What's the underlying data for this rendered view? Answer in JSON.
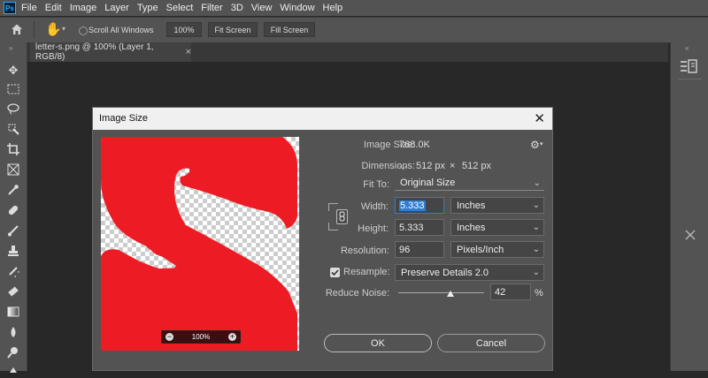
{
  "menu": {
    "logo": "Ps",
    "items": [
      "File",
      "Edit",
      "Image",
      "Layer",
      "Type",
      "Select",
      "Filter",
      "3D",
      "View",
      "Window",
      "Help"
    ]
  },
  "options_bar": {
    "scroll_all_label": "Scroll All Windows",
    "zoom_value": "100%",
    "fit_screen_label": "Fit Screen",
    "fill_screen_label": "Fill Screen"
  },
  "document_tab": {
    "title": "letter-s.png @ 100% (Layer 1, RGB/8)",
    "close": "×"
  },
  "dialog": {
    "title": "Image Size",
    "close": "✕",
    "preview_zoom": "100%",
    "preview_letter": "S",
    "accent_color": "#ed1c24",
    "image_size_label": "Image Size:",
    "image_size_value": "768.0K",
    "dimensions_label": "Dimensions:",
    "dimensions_width": "512 px",
    "dimensions_x": "×",
    "dimensions_height": "512 px",
    "fit_to_label": "Fit To:",
    "fit_to_value": "Original Size",
    "width_label": "Width:",
    "width_value": "5.333",
    "width_unit": "Inches",
    "height_label": "Height:",
    "height_value": "5.333",
    "height_unit": "Inches",
    "resolution_label": "Resolution:",
    "resolution_value": "96",
    "resolution_unit": "Pixels/Inch",
    "resample_checked": true,
    "resample_label": "Resample:",
    "resample_value": "Preserve Details 2.0",
    "reduce_noise_label": "Reduce Noise:",
    "reduce_noise_value": "42",
    "reduce_noise_fraction": 0.42,
    "reduce_noise_unit": "%",
    "ok_label": "OK",
    "cancel_label": "Cancel"
  }
}
